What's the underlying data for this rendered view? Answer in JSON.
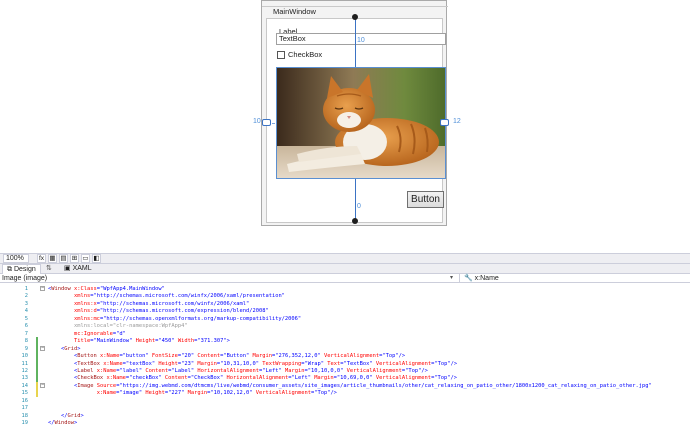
{
  "designer": {
    "window_title": "MainWindow",
    "label_text": "Label",
    "textbox_text": "TextBox",
    "checkbox_text": "CheckBox",
    "button_text": "Button",
    "margin_top": "10",
    "margin_top2": "0",
    "margin_left": "10",
    "margin_right": "12"
  },
  "zoombar": {
    "zoom": "100%",
    "fx_label": "fx"
  },
  "tabs": {
    "design": "Design",
    "xaml": "XAML"
  },
  "selector": {
    "element": "Image (image)",
    "property": "x:Name"
  },
  "code_lines": [
    {
      "n": "1",
      "html": "<span class='t-b'>&lt;</span><span class='t-e'>Window</span> <span class='t-a'>x:Class</span><span class='t-b'>=\"WpfApp4.MainWindow\"</span>"
    },
    {
      "n": "2",
      "html": "        <span class='t-a'>xmlns</span><span class='t-b'>=\"http://schemas.microsoft.com/winfx/2006/xaml/presentation\"</span>"
    },
    {
      "n": "3",
      "html": "        <span class='t-a'>xmlns:x</span><span class='t-b'>=\"http://schemas.microsoft.com/winfx/2006/xaml\"</span>"
    },
    {
      "n": "4",
      "html": "        <span class='t-a'>xmlns:d</span><span class='t-b'>=\"http://schemas.microsoft.com/expression/blend/2008\"</span>"
    },
    {
      "n": "5",
      "html": "        <span class='t-a'>xmlns:mc</span><span class='t-b'>=\"http://schemas.openxmlformats.org/markup-compatibility/2006\"</span>"
    },
    {
      "n": "6",
      "html": "        <span class='t-g'>xmlns:local=\"clr-namespace:WpfApp4\"</span>"
    },
    {
      "n": "7",
      "html": "        <span class='t-a'>mc:Ignorable</span><span class='t-b'>=\"d\"</span>"
    },
    {
      "n": "8",
      "html": "        <span class='t-a'>Title</span><span class='t-b'>=\"MainWindow\"</span> <span class='t-a'>Height</span><span class='t-b'>=\"450\"</span> <span class='t-a'>Width</span><span class='t-b'>=\"371.307\"</span><span class='t-b'>&gt;</span>"
    },
    {
      "n": "9",
      "html": "    <span class='t-b'>&lt;</span><span class='t-e'>Grid</span><span class='t-b'>&gt;</span>"
    },
    {
      "n": "10",
      "html": "        <span class='t-b'>&lt;</span><span class='t-e'>Button</span> <span class='t-a'>x:Name</span><span class='t-b'>=\"button\"</span> <span class='t-a'>FontSize</span><span class='t-b'>=\"20\"</span> <span class='t-a'>Content</span><span class='t-b'>=\"Button\"</span> <span class='t-a'>Margin</span><span class='t-b'>=\"276,352,12,0\"</span> <span class='t-a'>VerticalAlignment</span><span class='t-b'>=\"Top\"/&gt;</span>"
    },
    {
      "n": "11",
      "html": "        <span class='t-b'>&lt;</span><span class='t-e'>TextBox</span> <span class='t-a'>x:Name</span><span class='t-b'>=\"textBox\"</span> <span class='t-a'>Height</span><span class='t-b'>=\"23\"</span> <span class='t-a'>Margin</span><span class='t-b'>=\"10,31,10,0\"</span> <span class='t-a'>TextWrapping</span><span class='t-b'>=\"Wrap\"</span> <span class='t-a'>Text</span><span class='t-b'>=\"TextBox\"</span> <span class='t-a'>VerticalAlignment</span><span class='t-b'>=\"Top\"/&gt;</span>"
    },
    {
      "n": "12",
      "html": "        <span class='t-b'>&lt;</span><span class='t-e'>Label</span> <span class='t-a'>x:Name</span><span class='t-b'>=\"label\"</span> <span class='t-a'>Content</span><span class='t-b'>=\"Label\"</span> <span class='t-a'>HorizontalAlignment</span><span class='t-b'>=\"Left\"</span> <span class='t-a'>Margin</span><span class='t-b'>=\"10,10,0,0\"</span> <span class='t-a'>VerticalAlignment</span><span class='t-b'>=\"Top\"/&gt;</span>"
    },
    {
      "n": "13",
      "html": "        <span class='t-b'>&lt;</span><span class='t-e'>CheckBox</span> <span class='t-a'>x:Name</span><span class='t-b'>=\"checkBox\"</span> <span class='t-a'>Content</span><span class='t-b'>=\"CheckBox\"</span> <span class='t-a'>HorizontalAlignment</span><span class='t-b'>=\"Left\"</span> <span class='t-a'>Margin</span><span class='t-b'>=\"10,69,0,0\"</span> <span class='t-a'>VerticalAlignment</span><span class='t-b'>=\"Top\"/&gt;</span>"
    },
    {
      "n": "14",
      "html": "        <span class='t-b'>&lt;</span><span class='t-e'>Image</span> <span class='t-a'>Source</span><span class='t-b'>=\"https://img.webmd.com/dtmcms/live/webmd/consumer_assets/site_images/article_thumbnails/other/cat_relaxing_on_patio_other/1800x1200_cat_relaxing_on_patio_other.jpg\"</span>"
    },
    {
      "n": "15",
      "html": "               <span class='t-a'>x:Name</span><span class='t-b'>=\"image\"</span> <span class='t-a'>Height</span><span class='t-b'>=\"227\"</span> <span class='t-a'>Margin</span><span class='t-b'>=\"10,102,12,0\"</span> <span class='t-a'>VerticalAlignment</span><span class='t-b'>=\"Top\"/&gt;</span>"
    },
    {
      "n": "16",
      "html": ""
    },
    {
      "n": "17",
      "html": ""
    },
    {
      "n": "18",
      "html": "    <span class='t-b'>&lt;/</span><span class='t-e'>Grid</span><span class='t-b'>&gt;</span>"
    },
    {
      "n": "19",
      "html": "<span class='t-b'>&lt;/</span><span class='t-e'>Window</span><span class='t-b'>&gt;</span>"
    }
  ],
  "colors": {
    "change_bar_green": "#5fb35f",
    "change_bar_yellow": "#e8d44d",
    "selection_blue": "#3b73c4"
  }
}
